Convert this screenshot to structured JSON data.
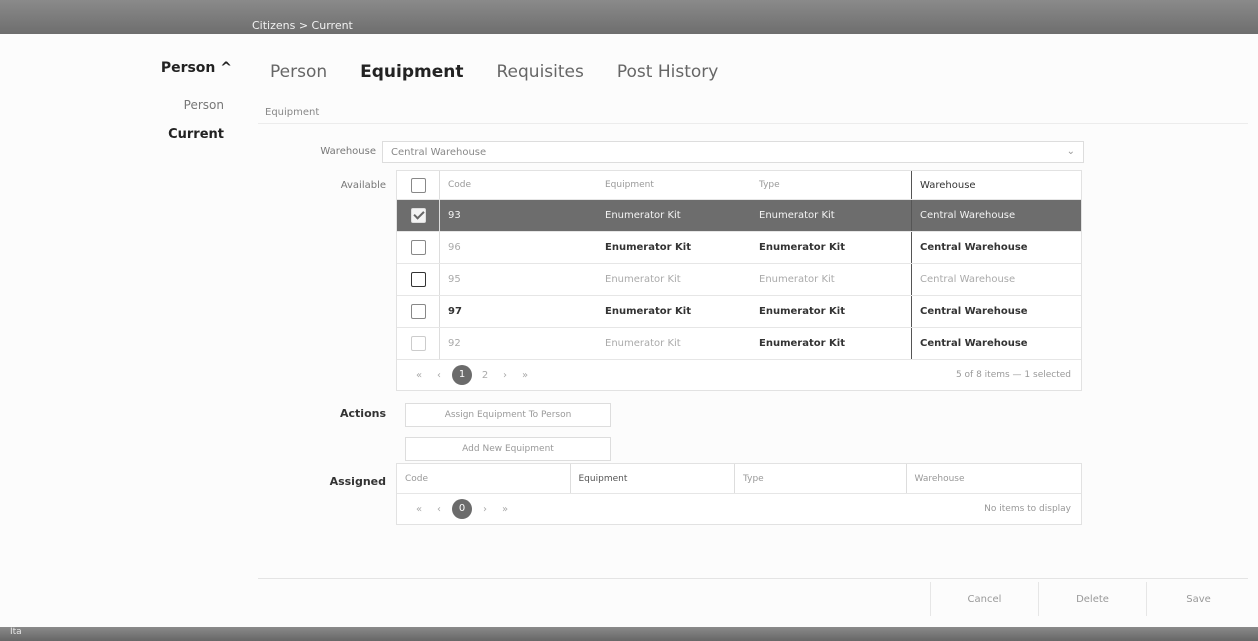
{
  "topbar": {
    "breadcrumb": "Citizens > Current"
  },
  "nav": {
    "title": "Person ^",
    "items": [
      {
        "label": "Person"
      },
      {
        "label": "Current"
      }
    ]
  },
  "tabs": [
    {
      "label": "Person"
    },
    {
      "label": "Equipment"
    },
    {
      "label": "Requisites"
    },
    {
      "label": "Post History"
    }
  ],
  "subtab": "Equipment",
  "warehouse": {
    "label": "Warehouse",
    "value": "Central Warehouse",
    "arrow": "⌄"
  },
  "available": {
    "label": "Available",
    "headers": {
      "code": "Code",
      "equipment": "Equipment",
      "type": "Type",
      "warehouse": "Warehouse"
    },
    "rows": [
      {
        "code": "93",
        "equipment": "Enumerator Kit",
        "type": "Enumerator Kit",
        "warehouse": "Central Warehouse"
      },
      {
        "code": "96",
        "equipment": "Enumerator Kit",
        "type": "Enumerator Kit",
        "warehouse": "Central Warehouse"
      },
      {
        "code": "95",
        "equipment": "Enumerator Kit",
        "type": "Enumerator Kit",
        "warehouse": "Central Warehouse"
      },
      {
        "code": "97",
        "equipment": "Enumerator Kit",
        "type": "Enumerator Kit",
        "warehouse": "Central Warehouse"
      },
      {
        "code": "92",
        "equipment": "Enumerator Kit",
        "type": "Enumerator Kit",
        "warehouse": "Central Warehouse"
      }
    ],
    "pager": {
      "first": "«",
      "prev": "‹",
      "current": "1",
      "next_page": "2",
      "next": "›",
      "last": "»",
      "info": "5 of 8 items — 1 selected"
    }
  },
  "actions": {
    "label": "Actions",
    "assign": "Assign Equipment To Person",
    "add": "Add New Equipment"
  },
  "assigned": {
    "label": "Assigned",
    "headers": {
      "code": "Code",
      "equipment": "Equipment",
      "type": "Type",
      "warehouse": "Warehouse"
    },
    "pager": {
      "first": "«",
      "prev": "‹",
      "current": "0",
      "next": "›",
      "last": "»",
      "info": "No items to display"
    }
  },
  "footer": {
    "cancel": "Cancel",
    "delete": "Delete",
    "save": "Save"
  },
  "corner": "Ita"
}
